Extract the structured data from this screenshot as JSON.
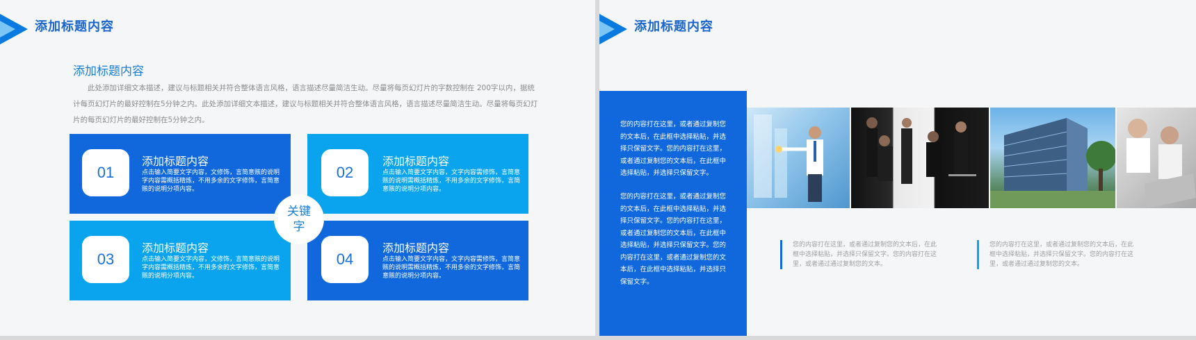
{
  "left": {
    "title": "添加标题内容",
    "sub_title": "添加标题内容",
    "description": "此处添加详细文本描述，建议与标题相关并符合整体语言风格，语言描述尽量简洁生动。尽量将每页幻灯片的字数控制在 200字以内，据统计每页幻灯片的最好控制在5分钟之内。此处添加详细文本描述，建议与标题相关并符合整体语言风格，语言描述尽量简洁生动。尽量将每页幻灯片的每页幻灯片的最好控制在5分钟之内。",
    "center_label": "关键字",
    "items": [
      {
        "num": "01",
        "title": "添加标题内容",
        "text": "点击输入简要文字内容，文修饰，言简意赅的说明字内容需概括精炼，不用多余的文字修饰，言简意赅的说明分项内容。"
      },
      {
        "num": "02",
        "title": "添加标题内容",
        "text": "点击输入简要文字内容，文字内容需修饰，言简意赅的说明需概括精炼，不用多余的文字修饰，言简意赅的说明分项内容。"
      },
      {
        "num": "03",
        "title": "添加标题内容",
        "text": "点击输入简要文字内容，文修饰，言简意赅的说明字内容需概括精炼，不用多余的文字修饰，言简意赅的说明分项内容。"
      },
      {
        "num": "04",
        "title": "添加标题内容",
        "text": "点击输入简要文字内容，文字内容需修饰，言简意赅的说明需概括精炼，不用多余的文字修饰，言简意赅的说明分项内容。"
      }
    ]
  },
  "right": {
    "title": "添加标题内容",
    "panel_text_1": "您的内容打在这里，或者通过复制您的文本后，在此框中选择粘贴，并选择只保留文字。您的内容打在这里，或者通过复制您的文本后，在此框中选择粘贴，并选择只保留文字。",
    "panel_text_2": "您的内容打在这里，或者通过复制您的文本后，在此框中选择粘贴，并选择只保留文字。您的内容打在这里，或者通过复制您的文本后，在此框中选择粘贴，并选择只保留文字。您的内容打在这里，或者通过复制您的文本后，在此框中选择粘贴，并选择只保留文字。",
    "quote_1": "您的内容打在这里，或者通过复制您的文本后，在此框中选择粘贴，并选择只保留文字。您的内容打在这里，或者通过通过复制您的文本。",
    "quote_2": "您的内容打在这里，或者通过复制您的文本后，在此框中选择粘贴，并选择只保留文字。您的内容打在这里，或者通过通过复制您的文本。"
  },
  "colors": {
    "primary": "#1168dd",
    "secondary": "#0aa4ee",
    "title": "#1a66cc"
  },
  "icons": [
    "corner-triangle-icon"
  ]
}
